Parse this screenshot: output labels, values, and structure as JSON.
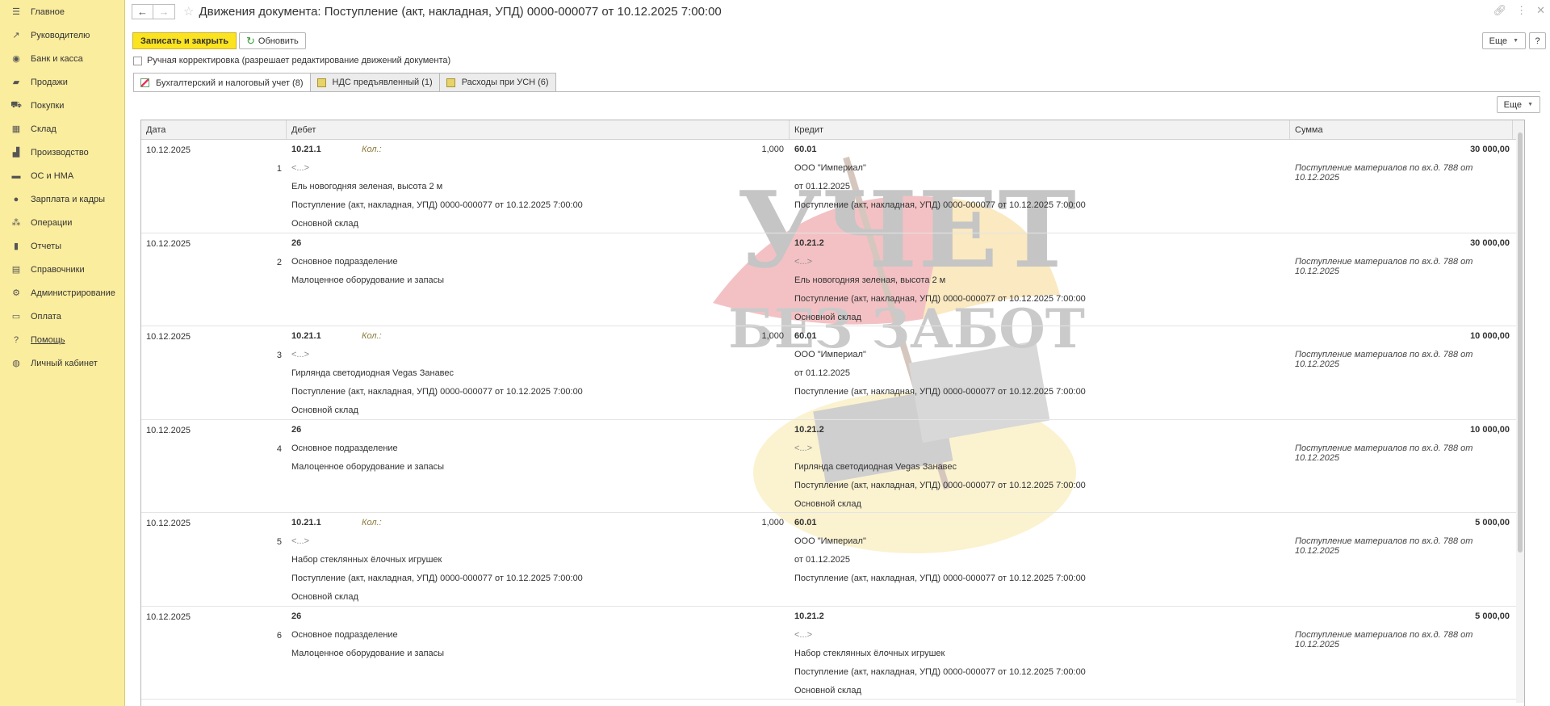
{
  "sidebar": {
    "items": [
      {
        "label": "Главное",
        "icon": "menu-icon"
      },
      {
        "label": "Руководителю",
        "icon": "trend-icon"
      },
      {
        "label": "Банк и касса",
        "icon": "bank-icon"
      },
      {
        "label": "Продажи",
        "icon": "bag-icon"
      },
      {
        "label": "Покупки",
        "icon": "cart-icon"
      },
      {
        "label": "Склад",
        "icon": "warehouse-icon"
      },
      {
        "label": "Производство",
        "icon": "factory-icon"
      },
      {
        "label": "ОС и НМА",
        "icon": "truck-icon"
      },
      {
        "label": "Зарплата и кадры",
        "icon": "person-icon"
      },
      {
        "label": "Операции",
        "icon": "operations-icon"
      },
      {
        "label": "Отчеты",
        "icon": "bar-chart-icon"
      },
      {
        "label": "Справочники",
        "icon": "books-icon"
      },
      {
        "label": "Администрирование",
        "icon": "gear-icon"
      },
      {
        "label": "Оплата",
        "icon": "card-icon"
      },
      {
        "label": "Помощь",
        "icon": "question-icon"
      },
      {
        "label": "Личный кабинет",
        "icon": "account-icon"
      }
    ]
  },
  "header": {
    "title": "Движения документа: Поступление (акт, накладная, УПД) 0000-000077 от 10.12.2025 7:00:00"
  },
  "toolbar": {
    "save_close": "Записать и закрыть",
    "refresh": "Обновить",
    "more": "Еще",
    "help": "?"
  },
  "manual_edit_label": "Ручная корректировка (разрешает редактирование движений документа)",
  "tabs": [
    "Бухгалтерский и налоговый учет (8)",
    "НДС предъявленный (1)",
    "Расходы при УСН (6)"
  ],
  "table_more": "Еще",
  "columns": {
    "date": "Дата",
    "debit": "Дебет",
    "credit": "Кредит",
    "sum": "Сумма"
  },
  "qty_label": "Кол.:",
  "rows": [
    {
      "date": "10.12.2025",
      "num": "1",
      "debit": {
        "account": "10.21.1",
        "qty": "1,000",
        "lines": [
          "<...>",
          "Ель новогодняя зеленая, высота 2 м",
          "Поступление (акт, накладная, УПД) 0000-000077 от 10.12.2025 7:00:00",
          "Основной склад"
        ]
      },
      "credit": {
        "account": "60.01",
        "lines": [
          "ООО \"Империал\"",
          "от 01.12.2025",
          "Поступление (акт, накладная, УПД) 0000-000077 от 10.12.2025 7:00:00",
          ""
        ]
      },
      "sum": "30 000,00",
      "note": "Поступление материалов по вх.д. 788 от 10.12.2025"
    },
    {
      "date": "10.12.2025",
      "num": "2",
      "debit": {
        "account": "26",
        "qty": "",
        "lines": [
          "Основное подразделение",
          "Малоценное оборудование и запасы",
          "",
          ""
        ]
      },
      "credit": {
        "account": "10.21.2",
        "lines": [
          "<...>",
          "Ель новогодняя зеленая, высота 2 м",
          "Поступление (акт, накладная, УПД) 0000-000077 от 10.12.2025 7:00:00",
          "Основной склад"
        ]
      },
      "sum": "30 000,00",
      "note": "Поступление материалов по вх.д. 788 от 10.12.2025"
    },
    {
      "date": "10.12.2025",
      "num": "3",
      "debit": {
        "account": "10.21.1",
        "qty": "1,000",
        "lines": [
          "<...>",
          "Гирлянда светодиодная Vegas Занавес",
          "Поступление (акт, накладная, УПД) 0000-000077 от 10.12.2025 7:00:00",
          "Основной склад"
        ]
      },
      "credit": {
        "account": "60.01",
        "lines": [
          "ООО \"Империал\"",
          "от 01.12.2025",
          "Поступление (акт, накладная, УПД) 0000-000077 от 10.12.2025 7:00:00",
          ""
        ]
      },
      "sum": "10 000,00",
      "note": "Поступление материалов по вх.д. 788 от 10.12.2025"
    },
    {
      "date": "10.12.2025",
      "num": "4",
      "debit": {
        "account": "26",
        "qty": "",
        "lines": [
          "Основное подразделение",
          "Малоценное оборудование и запасы",
          "",
          ""
        ]
      },
      "credit": {
        "account": "10.21.2",
        "lines": [
          "<...>",
          "Гирлянда светодиодная Vegas Занавес",
          "Поступление (акт, накладная, УПД) 0000-000077 от 10.12.2025 7:00:00",
          "Основной склад"
        ]
      },
      "sum": "10 000,00",
      "note": "Поступление материалов по вх.д. 788 от 10.12.2025"
    },
    {
      "date": "10.12.2025",
      "num": "5",
      "debit": {
        "account": "10.21.1",
        "qty": "1,000",
        "lines": [
          "<...>",
          "Набор стеклянных ёлочных игрушек",
          "Поступление (акт, накладная, УПД) 0000-000077 от 10.12.2025 7:00:00",
          "Основной склад"
        ]
      },
      "credit": {
        "account": "60.01",
        "lines": [
          "ООО \"Империал\"",
          "от 01.12.2025",
          "Поступление (акт, накладная, УПД) 0000-000077 от 10.12.2025 7:00:00",
          ""
        ]
      },
      "sum": "5 000,00",
      "note": "Поступление материалов по вх.д. 788 от 10.12.2025"
    },
    {
      "date": "10.12.2025",
      "num": "6",
      "debit": {
        "account": "26",
        "qty": "",
        "lines": [
          "Основное подразделение",
          "Малоценное оборудование и запасы",
          "",
          ""
        ]
      },
      "credit": {
        "account": "10.21.2",
        "lines": [
          "<...>",
          "Набор стеклянных ёлочных игрушек",
          "Поступление (акт, накладная, УПД) 0000-000077 от 10.12.2025 7:00:00",
          "Основной склад"
        ]
      },
      "sum": "5 000,00",
      "note": "Поступление материалов по вх.д. 788 от 10.12.2025"
    }
  ],
  "watermark": {
    "line1": "УЧЕТ",
    "line2": "БЕЗ ЗАБОТ"
  },
  "colors": {
    "sidebar_bg": "#fbed9e",
    "primary_button": "#fbe31f",
    "partial_row": "#fbf3c4"
  }
}
